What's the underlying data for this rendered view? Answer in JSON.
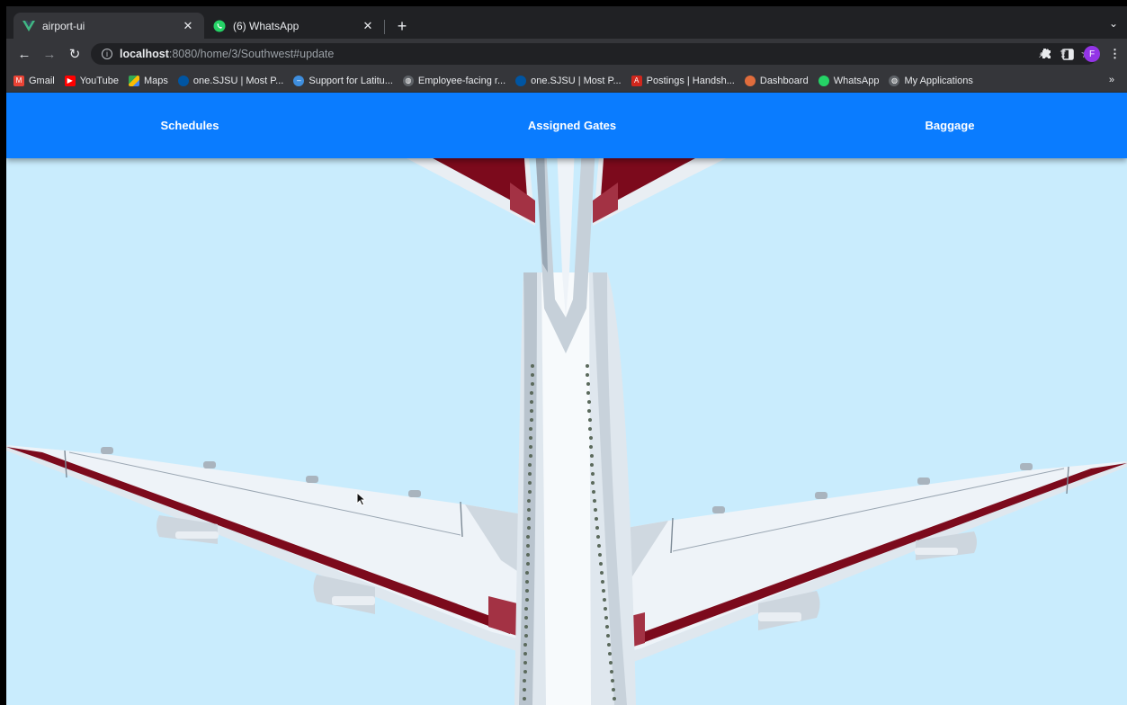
{
  "browser": {
    "tabs": [
      {
        "title": "airport-ui",
        "favicon": "vue-logo-icon",
        "active": true
      },
      {
        "title": "(6) WhatsApp",
        "favicon": "whatsapp-icon",
        "active": false
      }
    ],
    "url": {
      "host": "localhost",
      "path": ":8080/home/3/Southwest#update"
    },
    "profile_initial": "F",
    "bookmarks": [
      {
        "label": "Gmail",
        "icon": "gmail-icon",
        "color": "#ea4335"
      },
      {
        "label": "YouTube",
        "icon": "youtube-icon",
        "color": "#ff0000"
      },
      {
        "label": "Maps",
        "icon": "maps-icon",
        "color": "#34a853"
      },
      {
        "label": "one.SJSU | Most P...",
        "icon": "sjsu-icon",
        "color": "#0055a2"
      },
      {
        "label": "Support for Latitu...",
        "icon": "dell-icon",
        "color": "#3e8ede"
      },
      {
        "label": "Employee-facing r...",
        "icon": "globe-icon",
        "color": "#5f6368"
      },
      {
        "label": "one.SJSU | Most P...",
        "icon": "sjsu-icon",
        "color": "#0055a2"
      },
      {
        "label": "Postings | Handsh...",
        "icon": "adp-icon",
        "color": "#d0271d"
      },
      {
        "label": "Dashboard",
        "icon": "dashboard-icon",
        "color": "#e06c3c"
      },
      {
        "label": "WhatsApp",
        "icon": "whatsapp-icon",
        "color": "#25d366"
      },
      {
        "label": "My Applications",
        "icon": "globe-icon",
        "color": "#5f6368"
      }
    ]
  },
  "app": {
    "nav": {
      "schedules": "Schedules",
      "assigned_gates": "Assigned Gates",
      "baggage": "Baggage"
    },
    "colors": {
      "navbar": "#0a7cff",
      "sky": "#c9ecfd",
      "wing_stripe": "#7c0a1c"
    }
  }
}
